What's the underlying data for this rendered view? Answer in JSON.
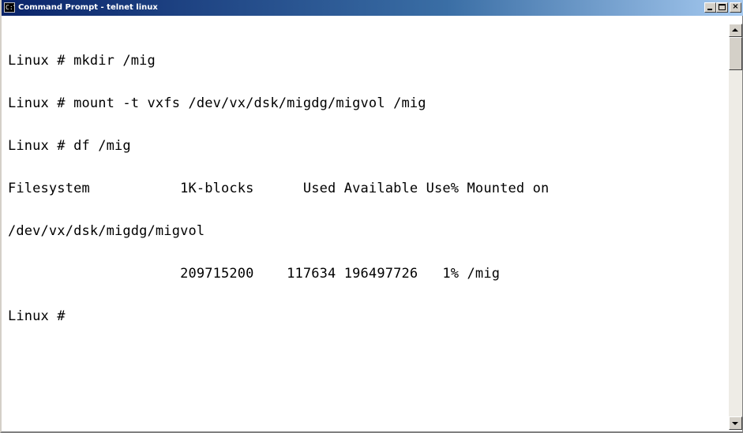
{
  "window": {
    "title": "Command Prompt - telnet linux",
    "icon": "console-icon",
    "icon_glyph": "C:\\"
  },
  "title_buttons": {
    "minimize": "minimize-icon",
    "maximize": "maximize-icon",
    "close": "close-icon",
    "close_glyph": "×"
  },
  "console": {
    "lines": [
      "Linux # mkdir /mig",
      "Linux # mount -t vxfs /dev/vx/dsk/migdg/migvol /mig",
      "Linux # df /mig",
      "Filesystem           1K-blocks      Used Available Use% Mounted on",
      "/dev/vx/dsk/migdg/migvol",
      "                     209715200    117634 196497726   1% /mig",
      "Linux #"
    ]
  },
  "scrollbar": {
    "up": "scroll-up-arrow-icon",
    "down": "scroll-down-arrow-icon"
  },
  "colors": {
    "titlebar_start": "#0a246a",
    "titlebar_end": "#a6caf0",
    "console_bg": "#ffffff",
    "console_fg": "#000000",
    "chrome": "#d4d0c8"
  }
}
